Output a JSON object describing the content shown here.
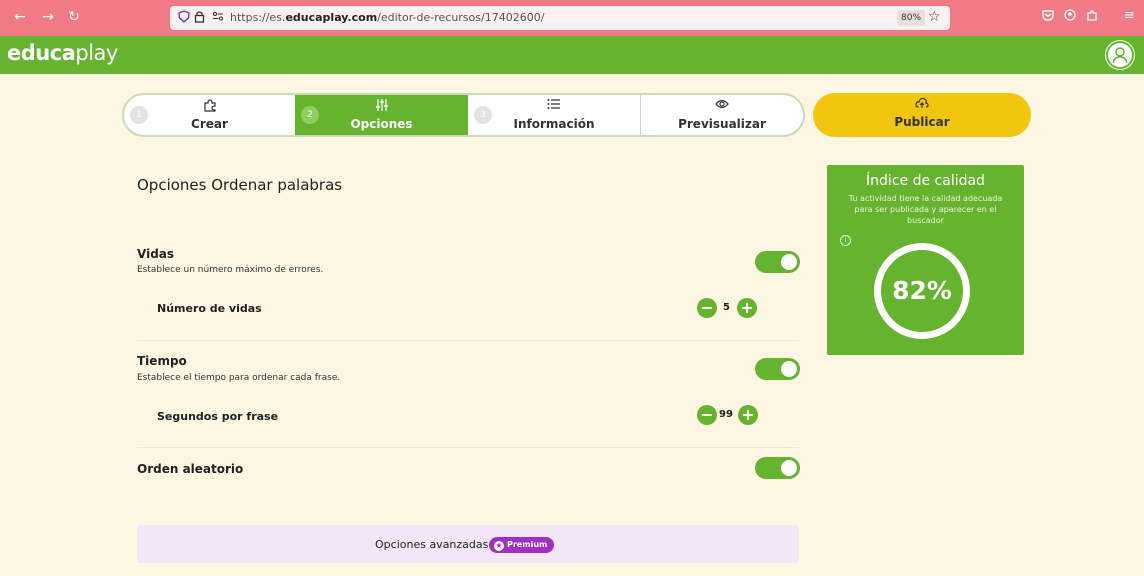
{
  "browser": {
    "url_prefix": "https://es.",
    "url_domain": "educaplay.com",
    "url_path": "/editor-de-recursos/17402600/",
    "zoom": "80%"
  },
  "header": {
    "logo_main": "educa",
    "logo_suffix": "play"
  },
  "steps": [
    {
      "num": "1",
      "icon": "puzzle-icon",
      "label": "Crear"
    },
    {
      "num": "2",
      "icon": "sliders-icon",
      "label": "Opciones"
    },
    {
      "num": "3",
      "icon": "list-icon",
      "label": "Información"
    },
    {
      "label": "Previsualizar",
      "icon": "eye-icon"
    }
  ],
  "publish": {
    "label": "Publicar",
    "icon": "cloud-upload-icon"
  },
  "options": {
    "title": "Opciones Ordenar palabras",
    "lives": {
      "title": "Vidas",
      "desc": "Establece un número máximo de errores.",
      "enabled": true,
      "sub_label": "Número de vidas",
      "value": "5"
    },
    "time": {
      "title": "Tiempo",
      "desc": "Establece el tiempo para ordenar cada frase.",
      "enabled": true,
      "sub_label": "Segundos por frase",
      "value": "99"
    },
    "random": {
      "title": "Orden aleatorio",
      "enabled": true
    },
    "advanced": {
      "label": "Opciones avanzadas",
      "badge": "Premium"
    }
  },
  "quality": {
    "title": "Índice de calidad",
    "desc": "Tu actividad tiene la calidad adecuada para ser publicada y aparecer en el buscador",
    "value": "82%",
    "accent": "#65b32e"
  }
}
